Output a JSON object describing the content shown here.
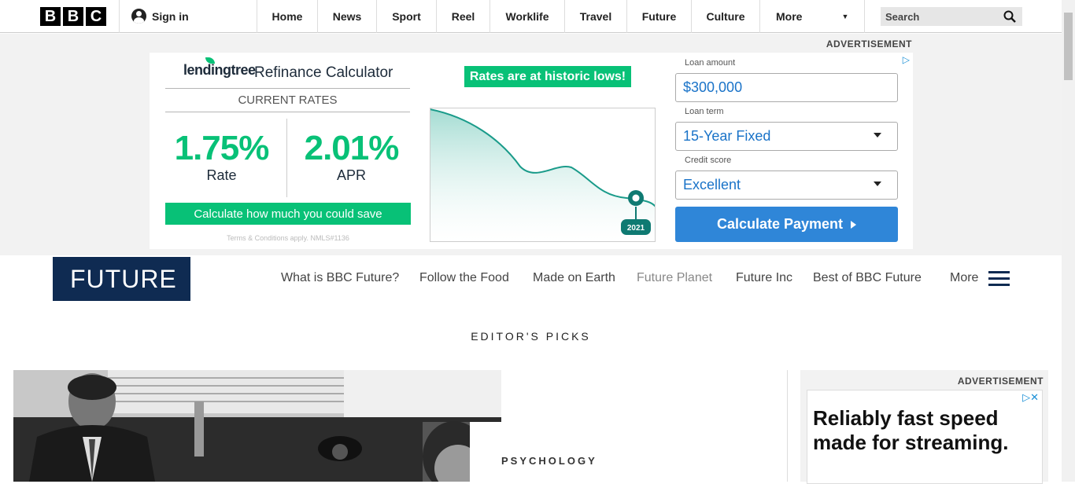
{
  "topnav": {
    "logo_letters": [
      "B",
      "B",
      "C"
    ],
    "signin": "Sign in",
    "links": [
      "Home",
      "News",
      "Sport",
      "Reel",
      "Worklife",
      "Travel",
      "Future",
      "Culture",
      "More"
    ],
    "search_placeholder": "Search"
  },
  "top_ad": {
    "label": "ADVERTISEMENT",
    "brand": "lendingtree",
    "title": "Refinance Calculator",
    "current_rates": "CURRENT RATES",
    "rate_value": "1.75%",
    "rate_label": "Rate",
    "apr_value": "2.01%",
    "apr_label": "APR",
    "cta_save": "Calculate how much you could save",
    "terms": "Terms & Conditions apply. NMLS#1136",
    "banner": "Rates are at historic lows!",
    "chart_year": "2021",
    "loan_amount_label": "Loan amount",
    "loan_amount_value": "$300,000",
    "loan_term_label": "Loan term",
    "loan_term_value": "15-Year Fixed",
    "credit_label": "Credit score",
    "credit_value": "Excellent",
    "calc_button": "Calculate Payment",
    "accent_color": "#08c177",
    "button_color": "#2f86d8"
  },
  "future": {
    "logo": "FUTURE",
    "nav": [
      "What is BBC Future?",
      "Follow the Food",
      "Made on Earth",
      "Future Planet",
      "Future Inc",
      "Best of BBC Future"
    ],
    "more": "More",
    "editors_picks": "EDITOR'S PICKS",
    "article_tag": "PSYCHOLOGY",
    "brand_color": "#0f2b52"
  },
  "side_ad": {
    "label": "ADVERTISEMENT",
    "headline": "Reliably fast speed made for streaming."
  }
}
